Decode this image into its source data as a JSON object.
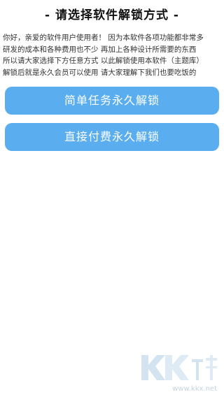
{
  "page": {
    "title": "- 请选择软件解锁方式 -",
    "intro_lines": [
      "你好，亲爱的软件用户使用者！ 因为本软件各项功能都非常多",
      "研发的成本和各种费用也不少  再加上各种设计所需要的东西",
      "所以请大家选择下方任意方式 以此解锁使用本软件（主题库）",
      "解锁后就是永久会员可以使用 请大家理解下我们也要吃饭的"
    ]
  },
  "buttons": {
    "task_unlock": "简单任务永久解锁",
    "pay_unlock": "直接付费永久解锁"
  },
  "watermark": {
    "logo_text": "KK下载",
    "url": "www.kkx.net"
  },
  "colors": {
    "button_bg": "#5aaef0",
    "button_text": "#ffffff",
    "background": "#ffffff"
  }
}
